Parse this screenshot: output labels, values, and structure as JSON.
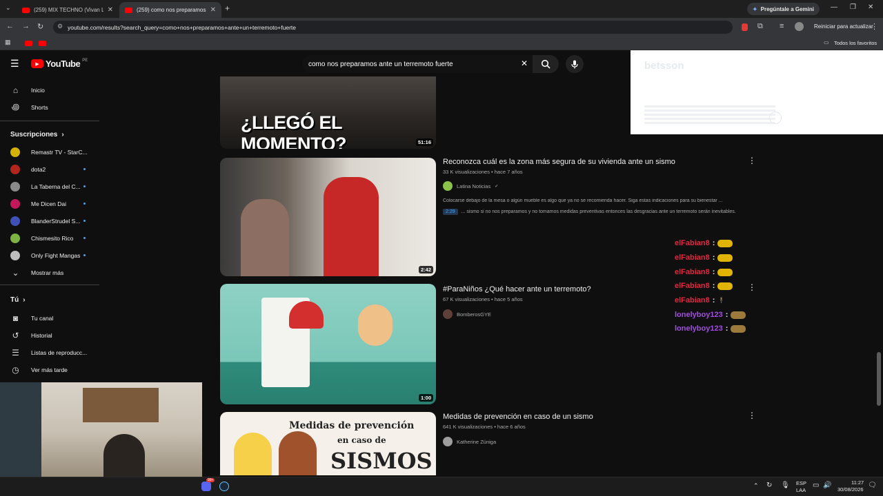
{
  "browser": {
    "tabs": [
      {
        "title": "(259) MIX TECHNO (Vivan Los 9"
      },
      {
        "title": "(259) como nos preparamos ar"
      }
    ],
    "new_tab": "+",
    "gemini_label": "Pregúntale a Gemini",
    "url": "youtube.com/results?search_query=como+nos+preparamos+ante+un+terremoto+fuerte",
    "update_label": "Reiniciar para actualizar",
    "bookmarks_all": "Todos los favoritos"
  },
  "youtube": {
    "logo": "YouTube",
    "region": "PE",
    "search_value": "como nos preparamos ante un terremoto fuerte",
    "sidebar": {
      "main": [
        {
          "label": "Inicio",
          "icon": "home-icon"
        },
        {
          "label": "Shorts",
          "icon": "shorts-icon"
        }
      ],
      "subscriptions_title": "Suscripciones",
      "subscriptions": [
        {
          "label": "Remastr TV - StarC...",
          "color": "#d4b106",
          "dot": false
        },
        {
          "label": "dota2",
          "color": "#b3261e",
          "dot": true
        },
        {
          "label": "La Taberna del C...",
          "color": "#8a8a8a",
          "dot": true
        },
        {
          "label": "Me Dicen Dai",
          "color": "#c2185b",
          "dot": true
        },
        {
          "label": "BlanderStrudel S...",
          "color": "#3f51b5",
          "dot": true
        },
        {
          "label": "Chismesito Rico",
          "color": "#7cb342",
          "dot": true
        },
        {
          "label": "Only Fight Mangas",
          "color": "#bdbdbd",
          "dot": true
        }
      ],
      "show_more": "Mostrar más",
      "you_title": "Tú",
      "you": [
        {
          "label": "Tu canal",
          "icon": "user-icon"
        },
        {
          "label": "Historial",
          "icon": "history-icon"
        },
        {
          "label": "Listas de reproducc...",
          "icon": "playlist-icon"
        },
        {
          "label": "Ver más tarde",
          "icon": "clock-icon"
        }
      ]
    },
    "videos": [
      {
        "thumb_text": "¿LLEGÓ EL MOMENTO?",
        "duration": "51:16"
      },
      {
        "title": "Reconozca cuál es la zona más segura de su vivienda ante un sismo",
        "meta": "33 K visualizaciones • hace 7 años",
        "channel": "Latina Noticias",
        "verified": "✔",
        "desc": "Colocarse debajo de la mesa o algún mueble es algo que ya no se recomienda hacer. Siga estas indicaciones para su bienestar ...",
        "chapter_time": "2:29",
        "chapter_text": "... sismo si no nos preparamos y no tomamos medidas preventivas entonces las desgracias ante un terremoto serán inevitables.",
        "duration": "2:42"
      },
      {
        "title": "#ParaNiños ¿Qué hacer ante un terremoto?",
        "meta": "67 K visualizaciones • hace 5 años",
        "channel": "BomberosGYE",
        "duration": "1:00"
      },
      {
        "title": "Medidas de prevención en caso de un sismo",
        "meta": "641 K visualizaciones • hace 6 años",
        "channel": "Katherine Zúniga",
        "thumb_line1": "Medidas de prevención",
        "thumb_line2": "en caso de",
        "thumb_line3": "SISMOS"
      }
    ]
  },
  "ad": {
    "brand": "betsson"
  },
  "chat": [
    {
      "user": "elFabian8",
      "color": "#e8233e"
    },
    {
      "user": "elFabian8",
      "color": "#e8233e"
    },
    {
      "user": "elFabian8",
      "color": "#e8233e"
    },
    {
      "user": "elFabian8",
      "color": "#e8233e"
    },
    {
      "user": "elFabian8",
      "color": "#e8233e"
    },
    {
      "user": "lonelyboy123",
      "color": "#a24de0"
    },
    {
      "user": "lonelyboy123",
      "color": "#a24de0"
    }
  ],
  "chat_sep": ":",
  "taskbar": {
    "lang1": "ESP",
    "lang2": "LAA",
    "time": "11:27",
    "date": "30/08/2026",
    "badge": "99+"
  }
}
